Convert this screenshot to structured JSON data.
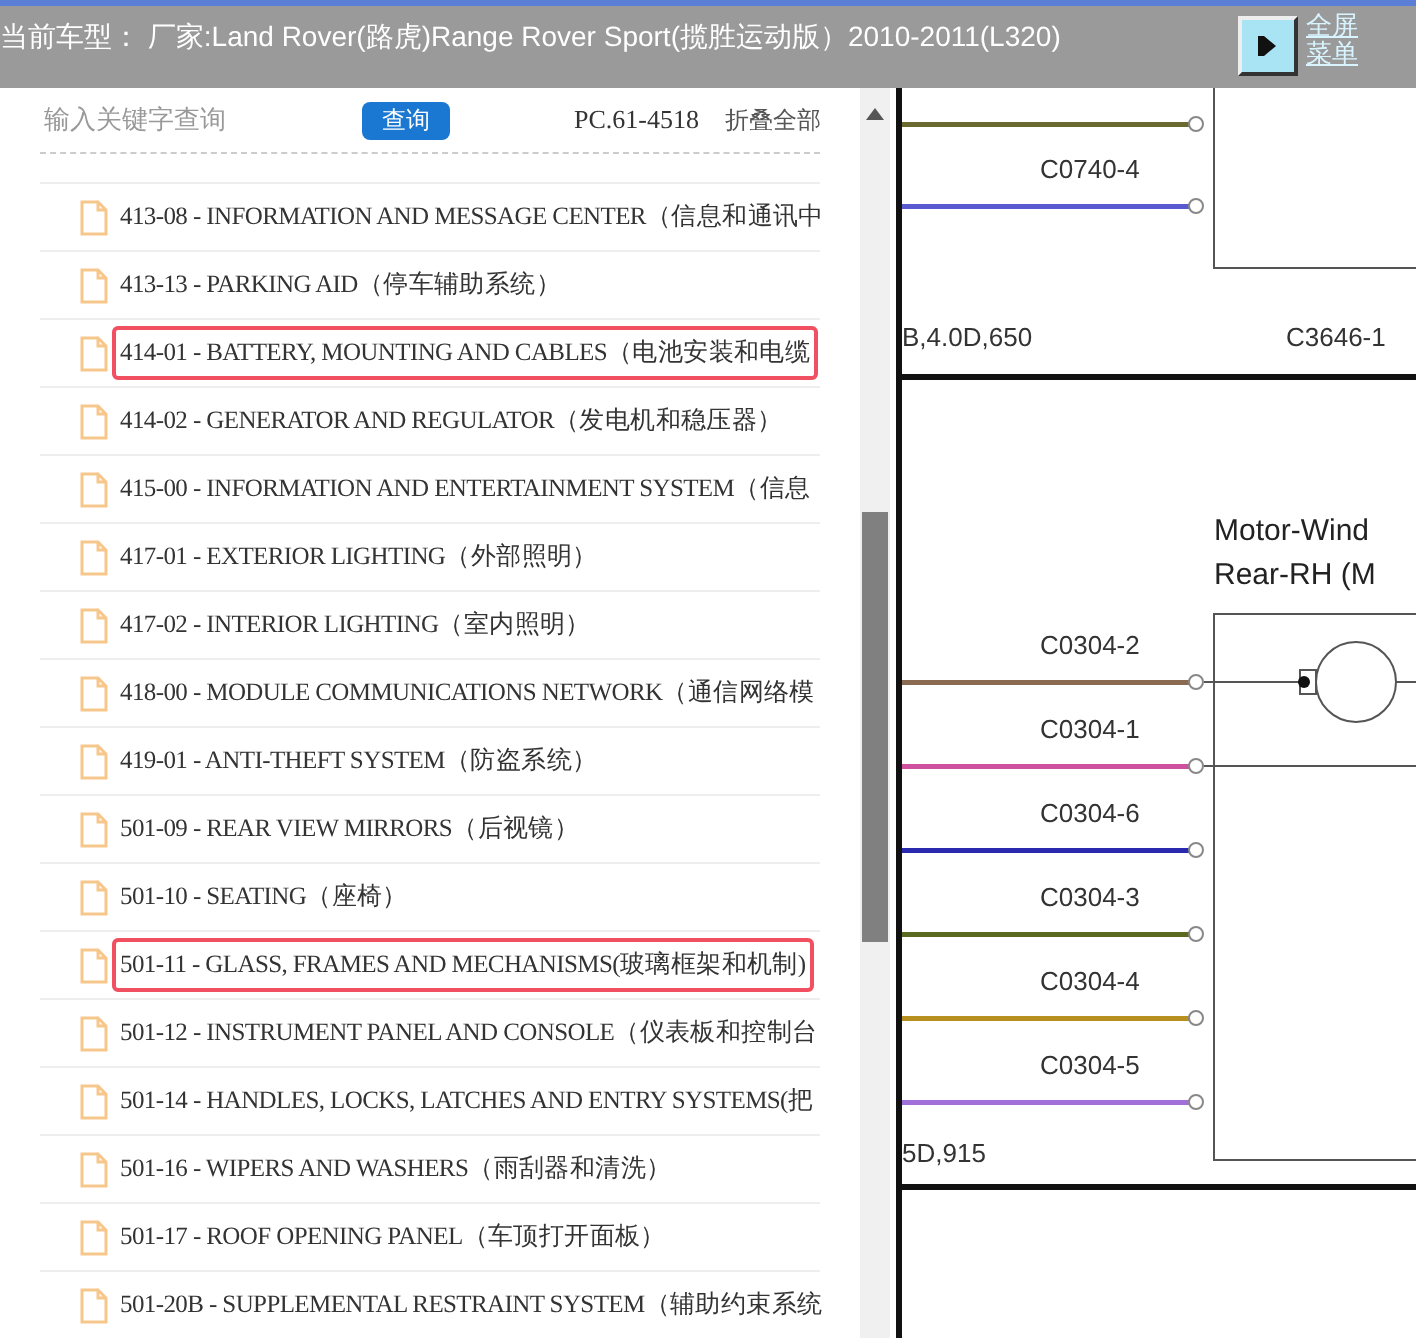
{
  "header": {
    "title": "当前车型： 厂家:Land Rover(路虎)Range Rover Sport(揽胜运动版）2010-2011(L320)",
    "links": [
      "全屏",
      "菜单"
    ]
  },
  "search": {
    "placeholder": "输入关键字查询",
    "button": "查询",
    "code": "PC.61-4518",
    "collapse": "折叠全部"
  },
  "items": [
    {
      "label": "413-08 - INFORMATION AND MESSAGE CENTER（信息和通讯中",
      "highlighted": false
    },
    {
      "label": "413-13 - PARKING AID（停车辅助系统）",
      "highlighted": false
    },
    {
      "label": "414-01 - BATTERY, MOUNTING AND CABLES（电池安装和电缆",
      "highlighted": true
    },
    {
      "label": "414-02 - GENERATOR AND REGULATOR（发电机和稳压器）",
      "highlighted": false
    },
    {
      "label": "415-00 - INFORMATION AND ENTERTAINMENT SYSTEM（信息",
      "highlighted": false
    },
    {
      "label": "417-01 - EXTERIOR LIGHTING（外部照明）",
      "highlighted": false
    },
    {
      "label": "417-02 - INTERIOR LIGHTING（室内照明）",
      "highlighted": false
    },
    {
      "label": "418-00 - MODULE COMMUNICATIONS NETWORK（通信网络模",
      "highlighted": false
    },
    {
      "label": "419-01 - ANTI-THEFT SYSTEM（防盗系统）",
      "highlighted": false
    },
    {
      "label": "501-09 - REAR VIEW MIRRORS（后视镜）",
      "highlighted": false
    },
    {
      "label": "501-10 - SEATING（座椅）",
      "highlighted": false
    },
    {
      "label": "501-11 - GLASS, FRAMES AND MECHANISMS(玻璃框架和机制)",
      "highlighted": true
    },
    {
      "label": "501-12 - INSTRUMENT PANEL AND CONSOLE（仪表板和控制台",
      "highlighted": false
    },
    {
      "label": "501-14 - HANDLES, LOCKS, LATCHES AND ENTRY SYSTEMS(把",
      "highlighted": false
    },
    {
      "label": "501-16 - WIPERS AND WASHERS（雨刮器和清洗）",
      "highlighted": false
    },
    {
      "label": "501-17 - ROOF OPENING PANEL（车顶打开面板）",
      "highlighted": false
    },
    {
      "label": "501-20B - SUPPLEMENTAL RESTRAINT SYSTEM（辅助约束系统",
      "highlighted": false
    }
  ],
  "diagram": {
    "top_pins": [
      {
        "label": "C0740-4",
        "color": "#5a5ad0"
      }
    ],
    "top_left_note": "B,4.0D,650",
    "top_right_note": "C3646-1",
    "component_title": [
      "Motor-Wind",
      "Rear-RH (M"
    ],
    "pins": [
      {
        "label": "C0304-2",
        "color": "#8a6a50"
      },
      {
        "label": "C0304-1",
        "color": "#d050a0"
      },
      {
        "label": "C0304-6",
        "color": "#2a2ab0"
      },
      {
        "label": "C0304-3",
        "color": "#5a6a20"
      },
      {
        "label": "C0304-4",
        "color": "#b89020"
      },
      {
        "label": "C0304-5",
        "color": "#a070d8"
      }
    ],
    "bottom_note": "5D,915"
  }
}
